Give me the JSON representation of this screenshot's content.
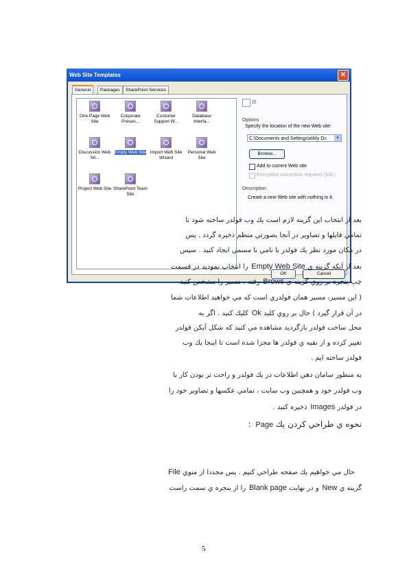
{
  "dialog": {
    "title": "Web Site Templates",
    "close": "✕",
    "tabs": [
      "General",
      "Packages",
      "SharePoint Services"
    ],
    "templates": [
      "One Page Web Site",
      "Corporate Presen...",
      "Customer Support W...",
      "Database Interfa...",
      "Discussion Web Sit...",
      "Empty Web Site",
      "Import Web Site Wizard",
      "Personal Web Site",
      "Project Web Site",
      "SharePoint Team Site"
    ],
    "selected_template": "Empty Web Site",
    "options_label": "Options",
    "location_label": "Specify the location of the new Web site:",
    "location_value": "C:\\Documents and Settings\\a\\My Dc",
    "browse": "Browse...",
    "add_current": "Add to current Web site",
    "ssl": "Encrypted connection required (SSL)",
    "description_label": "Description",
    "description": "Create a new Web site with nothing in it.",
    "ok": "OK",
    "cancel": "Cancel"
  },
  "body": {
    "lines": [
      "بعد از انتخاب اين گزينه لازم است يك وب فولدر ساخته شود تا",
      "تمامي فايلها و تصاوير در آنجا بصورتي منظم ذخيره گردد . پس",
      "در مكان مورد نظر يك فولدر با نامي با مسمي ايجاد كنيد . سپس",
      [
        "بعد از آنكه گزينه ي ",
        "Empty Web Site",
        " را انتخاب نموديد در قسمت"
      ],
      [
        "چپ پنجره بر روي گزينه ي ",
        "Brows",
        " رفته ، مسير را مشخص كنيد"
      ],
      "( اين مسير، مسير همان فولدري است كه مي خواهيد اطلاعات شما",
      [
        "در آن قرار گيرد ) حال بر روي كليد ",
        "Ok",
        " كليك كنيد . اگر به"
      ],
      "محل ساخت فولدر بازگرديد مشاهده مي كنيد كه شكل آيكن فولدر",
      "تغيير كرده و از بقيه ي فولدر ها مجزا شده است تا اينجا يك وب",
      "فولدر ساخته ايم .",
      "به منظور سامان دهي اطلاعات در يك فولدر و راحت تر بودن كار با",
      "وب فولدر خود و همچنين وب سايت ، تمامي عكسها و تصاوير خود را",
      [
        "در فولدر ",
        "Images",
        " ذخيره كنيد ."
      ],
      [
        "نحوه ي طراحي كردن يك ",
        "Page",
        " :"
      ],
      [
        "حال مي خواهيم يك صفحه طراحي كنيم . پس مجددا از منوي ",
        "File",
        ""
      ],
      [
        "گزينه ي ",
        "New",
        " و در نهايت ",
        "Blank page",
        " را از پنجره ي سمت راست"
      ]
    ],
    "page_number": "5"
  }
}
